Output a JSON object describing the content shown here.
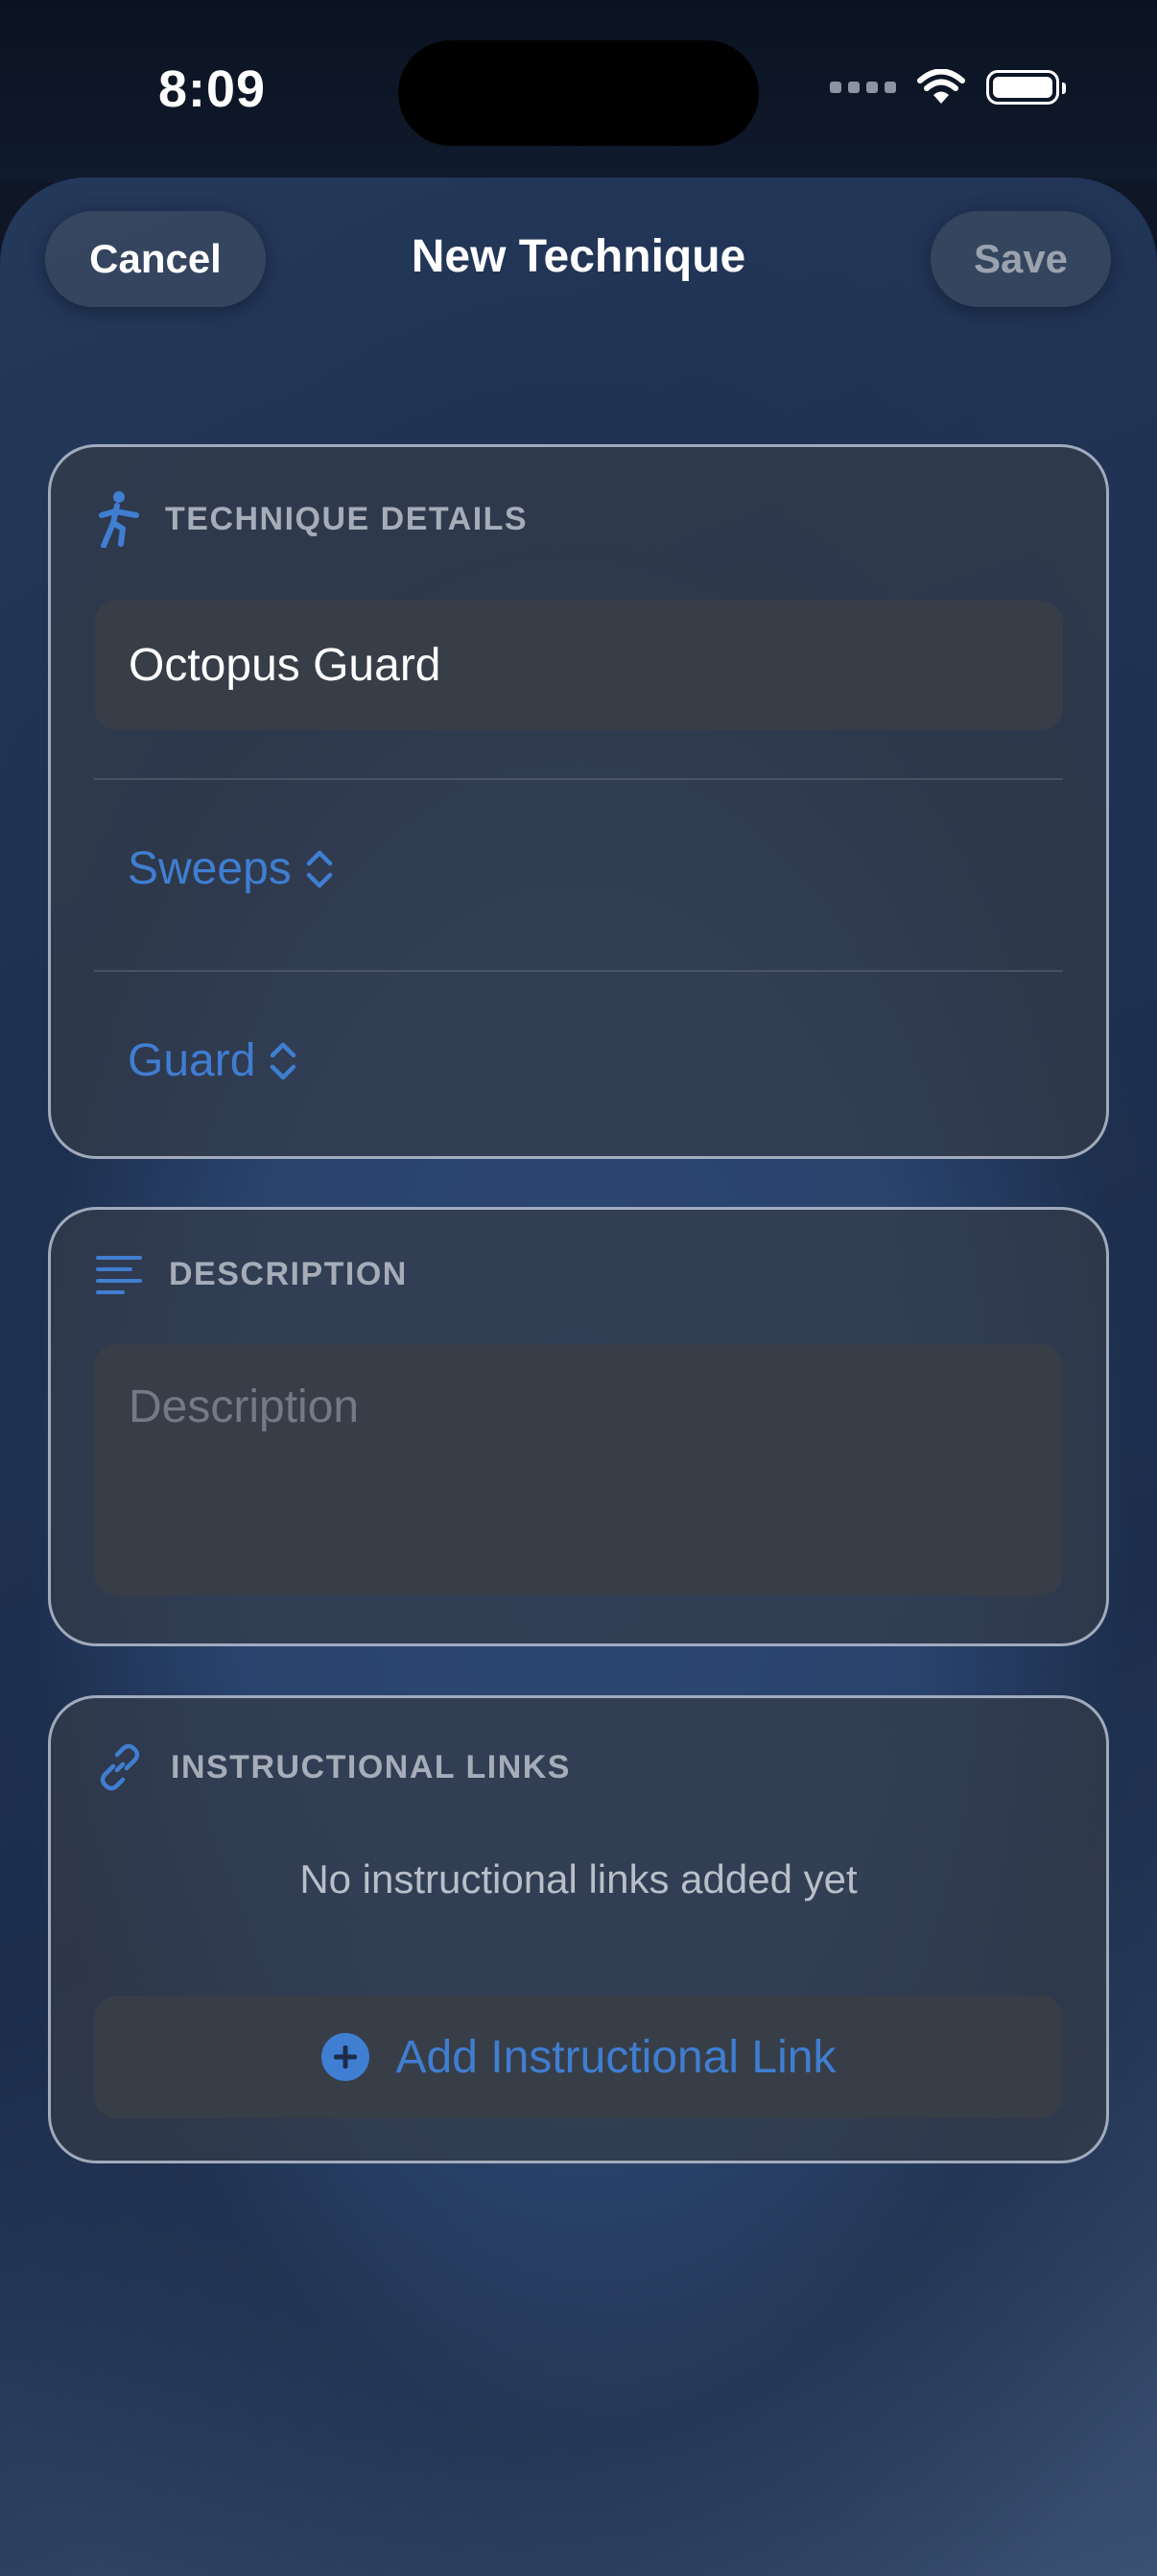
{
  "status_bar": {
    "time": "8:09",
    "icons": [
      "signal-dots-icon",
      "wifi-icon",
      "battery-icon"
    ]
  },
  "nav": {
    "cancel_label": "Cancel",
    "title": "New Technique",
    "save_label": "Save"
  },
  "technique_details": {
    "header": "TECHNIQUE DETAILS",
    "icon": "figure-kick-icon",
    "name_value": "Octopus Guard",
    "category_picker": "Sweeps",
    "position_picker": "Guard"
  },
  "description": {
    "header": "DESCRIPTION",
    "icon": "text-lines-icon",
    "placeholder": "Description"
  },
  "instructional_links": {
    "header": "INSTRUCTIONAL LINKS",
    "icon": "link-icon",
    "empty_text": "No instructional links added yet",
    "add_button_label": "Add Instructional Link"
  },
  "colors": {
    "accent": "#3f7ed1",
    "card_border": "#c8d2e1",
    "secondary_text": "#a6adb8"
  }
}
